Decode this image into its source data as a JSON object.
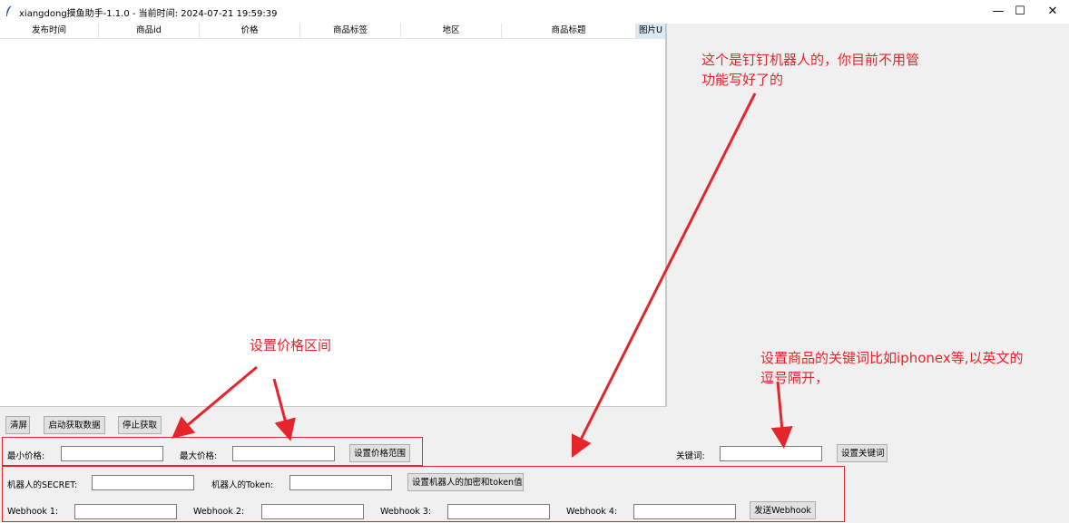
{
  "window": {
    "title": "xiangdong摸鱼助手-1.1.0 - 当前时间: 2024-07-21 19:59:39",
    "minimize_glyph": "—",
    "maximize_glyph": "☐",
    "close_glyph": "✕"
  },
  "table": {
    "columns": [
      "发布时间",
      "商品id",
      "价格",
      "商品标签",
      "地区",
      "商品标题",
      "图片U"
    ]
  },
  "toolbar": {
    "clear_label": "清屏",
    "start_label": "启动获取数据",
    "stop_label": "停止获取"
  },
  "price": {
    "min_label": "最小价格:",
    "min_value": "",
    "max_label": "最大价格:",
    "max_value": "",
    "set_button": "设置价格范围"
  },
  "keyword": {
    "label": "关键词:",
    "value": "",
    "set_button": "设置关键词"
  },
  "robot": {
    "secret_label": "机器人的SECRET:",
    "secret_value": "",
    "token_label": "机器人的Token:",
    "token_value": "",
    "set_button": "设置机器人的加密和token值"
  },
  "webhooks": [
    {
      "label": "Webhook 1:",
      "value": ""
    },
    {
      "label": "Webhook 2:",
      "value": ""
    },
    {
      "label": "Webhook 3:",
      "value": ""
    },
    {
      "label": "Webhook 4:",
      "value": ""
    }
  ],
  "webhook_send_button": "发送Webhook",
  "annotations": {
    "dingtalk_note_line1": "这个是钉钉机器人的，你目前不用管",
    "dingtalk_note_line2": "功能写好了的",
    "price_note": "设置价格区间",
    "keyword_note_line1": "设置商品的关键词比如iphonex等,以英文的",
    "keyword_note_line2": "逗号隔开，"
  },
  "colors": {
    "annotation_red": "#e6242b",
    "header_selected": "#dbe8f5"
  }
}
